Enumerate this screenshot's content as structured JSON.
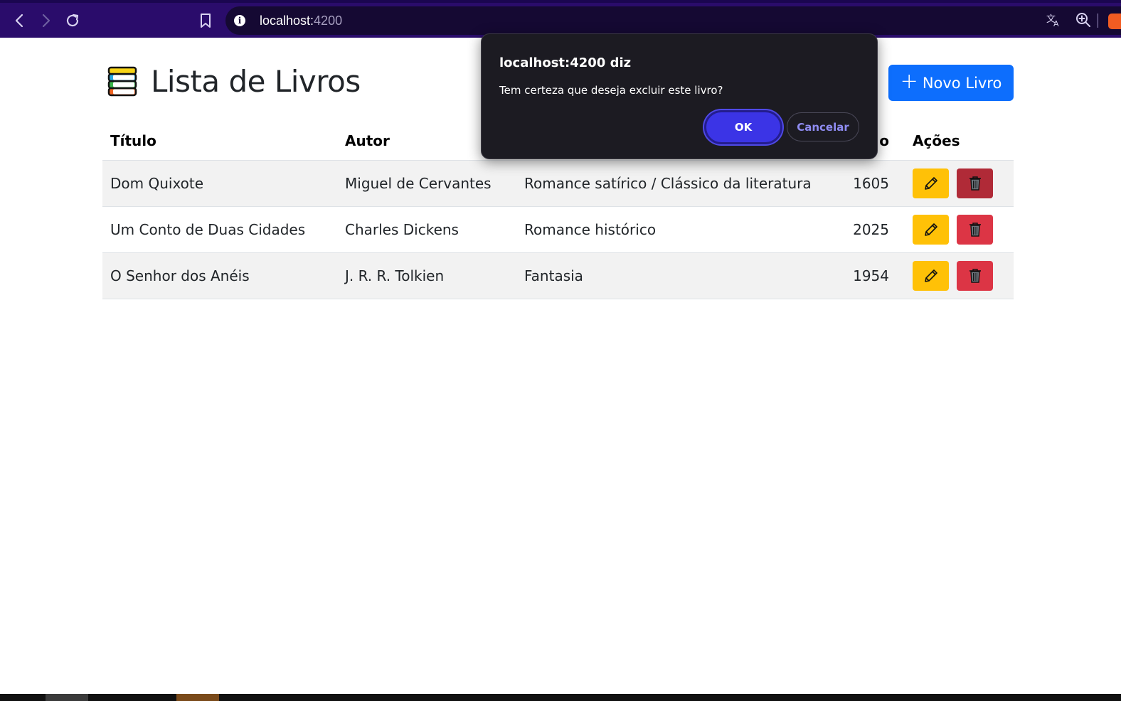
{
  "browser": {
    "url_host": "localhost:",
    "url_port": "4200"
  },
  "page": {
    "title": "Lista de Livros",
    "new_button_label": "Novo Livro"
  },
  "table": {
    "headers": {
      "titulo": "Título",
      "autor": "Autor",
      "ano": "o",
      "acoes": "Ações"
    },
    "rows": [
      {
        "titulo": "Dom Quixote",
        "autor": "Miguel de Cervantes",
        "genero": "Romance satírico / Clássico da literatura",
        "ano": "1605"
      },
      {
        "titulo": "Um Conto de Duas Cidades",
        "autor": "Charles Dickens",
        "genero": "Romance histórico",
        "ano": "2025"
      },
      {
        "titulo": "O Senhor dos Anéis",
        "autor": "J. R. R. Tolkien",
        "genero": "Fantasia",
        "ano": "1954"
      }
    ]
  },
  "dialog": {
    "title": "localhost:4200 diz",
    "message": "Tem certeza que deseja excluir este livro?",
    "ok_label": "OK",
    "cancel_label": "Cancelar"
  },
  "colors": {
    "primary": "#0d6efd",
    "warning": "#ffc107",
    "danger": "#dc3545",
    "browser_bar": "#2a0c6b"
  }
}
